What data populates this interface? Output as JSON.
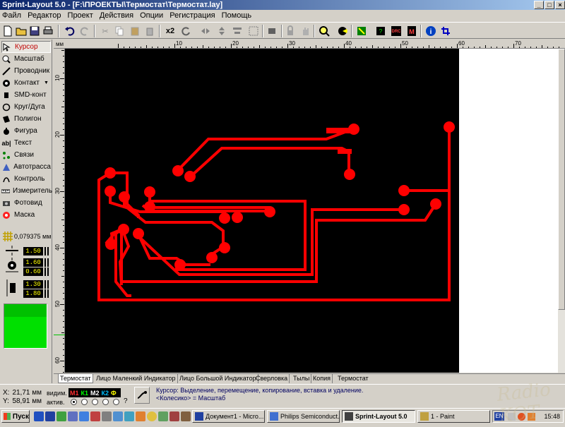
{
  "window": {
    "title": "Sprint-Layout 5.0 - [F:\\ПРОЕКТЫ\\Термостат\\Термостат.lay]",
    "controls": [
      "_",
      "□",
      "×"
    ]
  },
  "menu": [
    "Файл",
    "Редактор",
    "Проект",
    "Действия",
    "Опции",
    "Регистрация",
    "Помощь"
  ],
  "toolbar": {
    "zoom_label": "x2"
  },
  "tools": [
    {
      "label": "Курсор",
      "icon": "cursor-arrow-icon",
      "active": true
    },
    {
      "label": "Масштаб",
      "icon": "magnifier-icon"
    },
    {
      "label": "Проводник",
      "icon": "track-icon"
    },
    {
      "label": "Контакт",
      "icon": "pad-icon",
      "dropdown": true
    },
    {
      "label": "SMD-конт",
      "icon": "smd-pad-icon"
    },
    {
      "label": "Круг/Дуга",
      "icon": "circle-arc-icon"
    },
    {
      "label": "Полигон",
      "icon": "polygon-icon"
    },
    {
      "label": "Фигура",
      "icon": "figure-icon"
    },
    {
      "label": "Текст",
      "icon": "text-icon"
    },
    {
      "label": "Связи",
      "icon": "connections-icon"
    },
    {
      "label": "Автотрасса",
      "icon": "autoroute-icon"
    },
    {
      "label": "Контроль",
      "icon": "test-icon"
    },
    {
      "label": "Измеритель",
      "icon": "ruler-icon"
    },
    {
      "label": "Фотовид",
      "icon": "camera-icon"
    },
    {
      "label": "Маска",
      "icon": "mask-icon"
    }
  ],
  "grid": {
    "value": "0,079375 мм"
  },
  "track_width": "1.50",
  "pad_sizes": {
    "outer": "1.60",
    "inner": "0.60"
  },
  "smd_sizes": {
    "w": "1.30",
    "h": "1.80"
  },
  "ruler": {
    "unit": "мм",
    "h_labels": [
      "10",
      "20",
      "30",
      "40",
      "50",
      "60",
      "70"
    ],
    "v_labels": [
      "10",
      "20",
      "30",
      "40",
      "50",
      "60"
    ]
  },
  "tabs": [
    {
      "label": "Термостат",
      "active": true
    },
    {
      "label": "Лицо Маленкий Индикатор"
    },
    {
      "label": "Лицо Большой Индикатор"
    },
    {
      "label": "Сверловка"
    },
    {
      "label": "Тылы"
    },
    {
      "label": "Копия"
    },
    {
      "label": "Термостат"
    }
  ],
  "status": {
    "x_label": "X:",
    "x_value": "21,71 мм",
    "y_label": "Y:",
    "y_value": "58,91 мм",
    "visible_label": "видим.",
    "active_label": "актив.",
    "layers": [
      "М1",
      "К1",
      "М2",
      "К2",
      "Ф"
    ],
    "question": "?",
    "hint_line1": "Курсор: Выделение, перемещение, копирование, вставка и удаление.",
    "hint_line2": "<Колесико> = Масштаб"
  },
  "taskbar": {
    "start": "Пуск",
    "tasks": [
      {
        "label": "Документ1 - Micro..."
      },
      {
        "label": "Philips Semiconduct..."
      },
      {
        "label": "Sprint-Layout 5.0",
        "active": true
      },
      {
        "label": "1 - Paint"
      }
    ],
    "lang": "EN",
    "clock": "15:48"
  },
  "colors": {
    "copper": "#ff0000",
    "board": "#000000",
    "title_start": "#0a246a",
    "title_end": "#a6caf0"
  }
}
